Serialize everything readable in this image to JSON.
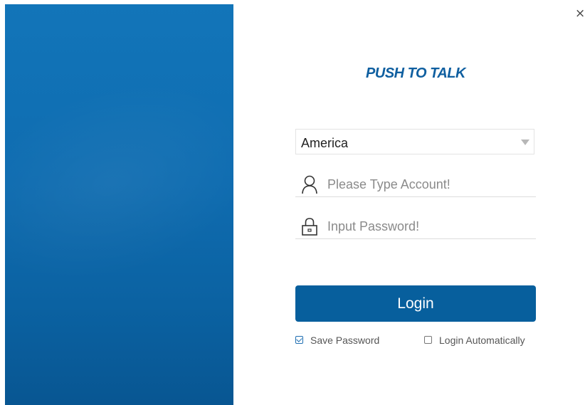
{
  "window": {
    "close_glyph": "×"
  },
  "app": {
    "title": "PUSH TO TALK"
  },
  "region_select": {
    "selected": "America",
    "icon": "chevron-down-icon"
  },
  "account_field": {
    "value": "",
    "placeholder": "Please Type Account!",
    "icon": "user-icon"
  },
  "password_field": {
    "value": "",
    "placeholder": "Input Password!",
    "icon": "lock-icon"
  },
  "login_button": {
    "label": "Login"
  },
  "options": {
    "save_password": {
      "label": "Save Password",
      "checked": true
    },
    "login_automatically": {
      "label": "Login Automatically",
      "checked": false
    }
  },
  "colors": {
    "brand": "#0f5fa0",
    "button": "#075f9d",
    "panel_top": "#1275b9",
    "panel_bottom": "#085692"
  }
}
